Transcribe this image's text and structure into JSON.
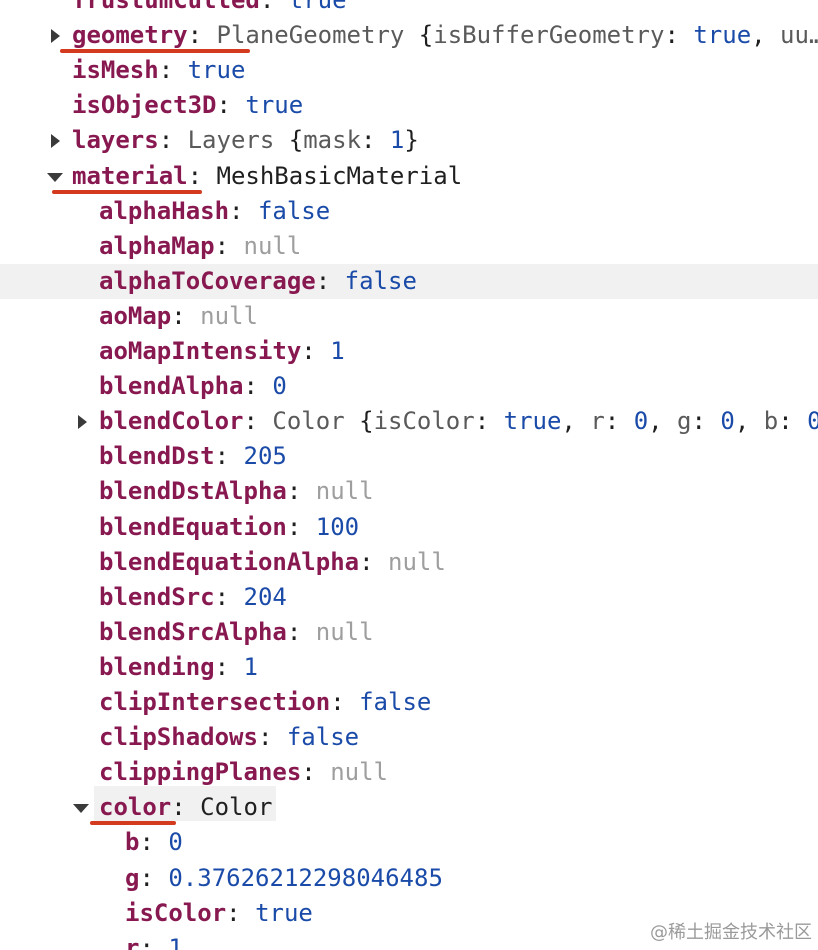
{
  "inspector": {
    "rows": [
      {
        "indent": 0,
        "toggle": "none",
        "key": "frustumCulled",
        "value": "true",
        "value_type": "bool",
        "partial_top": true
      },
      {
        "indent": 0,
        "toggle": "collapsed",
        "key": "geometry",
        "value": "PlaneGeometry",
        "value_type": "class",
        "preview": " {isBufferGeometry: true, uu…",
        "underline": true
      },
      {
        "indent": 0,
        "toggle": "none",
        "key": "isMesh",
        "value": "true",
        "value_type": "bool"
      },
      {
        "indent": 0,
        "toggle": "none",
        "key": "isObject3D",
        "value": "true",
        "value_type": "bool"
      },
      {
        "indent": 0,
        "toggle": "collapsed",
        "key": "layers",
        "value": "Layers",
        "value_type": "class",
        "preview_parts": [
          {
            "t": " {",
            "c": "punct"
          },
          {
            "t": "mask",
            "c": "class"
          },
          {
            "t": ": ",
            "c": "punct"
          },
          {
            "t": "1",
            "c": "num"
          },
          {
            "t": "}",
            "c": "punct"
          }
        ]
      },
      {
        "indent": 0,
        "toggle": "expanded",
        "key": "material",
        "value": "MeshBasicMaterial",
        "value_type": "class-expanded",
        "underline": true
      },
      {
        "indent": 1,
        "toggle": "none",
        "key": "alphaHash",
        "value": "false",
        "value_type": "bool"
      },
      {
        "indent": 1,
        "toggle": "none",
        "key": "alphaMap",
        "value": "null",
        "value_type": "null"
      },
      {
        "indent": 1,
        "toggle": "none",
        "key": "alphaToCoverage",
        "value": "false",
        "value_type": "bool",
        "highlight": true
      },
      {
        "indent": 1,
        "toggle": "none",
        "key": "aoMap",
        "value": "null",
        "value_type": "null"
      },
      {
        "indent": 1,
        "toggle": "none",
        "key": "aoMapIntensity",
        "value": "1",
        "value_type": "num"
      },
      {
        "indent": 1,
        "toggle": "none",
        "key": "blendAlpha",
        "value": "0",
        "value_type": "num"
      },
      {
        "indent": 1,
        "toggle": "collapsed",
        "key": "blendColor",
        "value": "Color",
        "value_type": "class",
        "preview_parts": [
          {
            "t": " {",
            "c": "punct"
          },
          {
            "t": "isColor",
            "c": "class"
          },
          {
            "t": ": ",
            "c": "punct"
          },
          {
            "t": "true",
            "c": "num"
          },
          {
            "t": ", ",
            "c": "punct"
          },
          {
            "t": "r",
            "c": "class"
          },
          {
            "t": ": ",
            "c": "punct"
          },
          {
            "t": "0",
            "c": "num"
          },
          {
            "t": ", ",
            "c": "punct"
          },
          {
            "t": "g",
            "c": "class"
          },
          {
            "t": ": ",
            "c": "punct"
          },
          {
            "t": "0",
            "c": "num"
          },
          {
            "t": ", ",
            "c": "punct"
          },
          {
            "t": "b",
            "c": "class"
          },
          {
            "t": ": ",
            "c": "punct"
          },
          {
            "t": "0",
            "c": "num"
          }
        ]
      },
      {
        "indent": 1,
        "toggle": "none",
        "key": "blendDst",
        "value": "205",
        "value_type": "num"
      },
      {
        "indent": 1,
        "toggle": "none",
        "key": "blendDstAlpha",
        "value": "null",
        "value_type": "null"
      },
      {
        "indent": 1,
        "toggle": "none",
        "key": "blendEquation",
        "value": "100",
        "value_type": "num"
      },
      {
        "indent": 1,
        "toggle": "none",
        "key": "blendEquationAlpha",
        "value": "null",
        "value_type": "null"
      },
      {
        "indent": 1,
        "toggle": "none",
        "key": "blendSrc",
        "value": "204",
        "value_type": "num"
      },
      {
        "indent": 1,
        "toggle": "none",
        "key": "blendSrcAlpha",
        "value": "null",
        "value_type": "null"
      },
      {
        "indent": 1,
        "toggle": "none",
        "key": "blending",
        "value": "1",
        "value_type": "num"
      },
      {
        "indent": 1,
        "toggle": "none",
        "key": "clipIntersection",
        "value": "false",
        "value_type": "bool"
      },
      {
        "indent": 1,
        "toggle": "none",
        "key": "clipShadows",
        "value": "false",
        "value_type": "bool"
      },
      {
        "indent": 1,
        "toggle": "none",
        "key": "clippingPlanes",
        "value": "null",
        "value_type": "null"
      },
      {
        "indent": 1,
        "toggle": "expanded",
        "key": "color",
        "value": "Color",
        "value_type": "class-expanded",
        "underline": true
      },
      {
        "indent": 2,
        "toggle": "none",
        "key": "b",
        "value": "0",
        "value_type": "num"
      },
      {
        "indent": 2,
        "toggle": "none",
        "key": "g",
        "value": "0.37626212298046485",
        "value_type": "num"
      },
      {
        "indent": 2,
        "toggle": "none",
        "key": "isColor",
        "value": "true",
        "value_type": "bool"
      },
      {
        "indent": 2,
        "toggle": "none",
        "key": "r",
        "value": "1",
        "value_type": "num",
        "partial_bottom": true
      }
    ]
  },
  "watermark": "@稀土掘金技术社区",
  "colors": {
    "key": "#881850",
    "bool_num": "#1a4ba8",
    "null": "#9e9e9e",
    "class": "#5a5a5a",
    "annotation_underline": "#d33a1e",
    "hover_row": "#f1f1f1"
  },
  "icons": {
    "collapsed": "triangle-right-icon",
    "expanded": "triangle-down-icon"
  }
}
